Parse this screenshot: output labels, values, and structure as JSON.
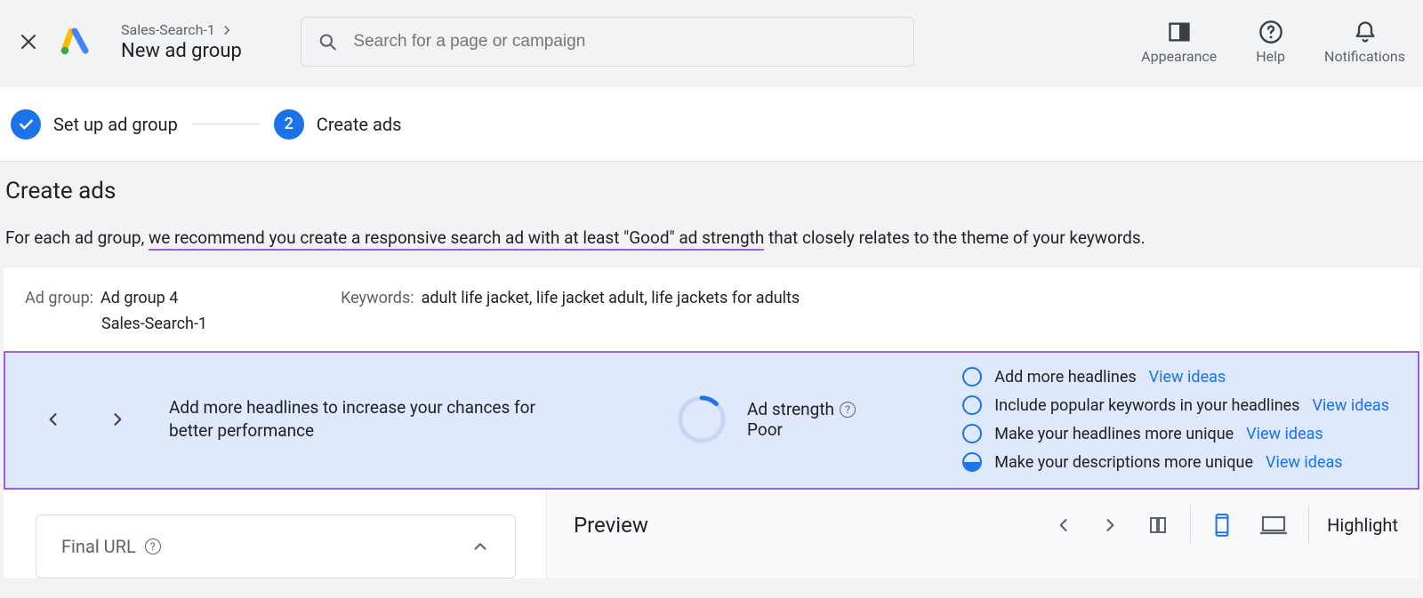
{
  "header": {
    "breadcrumb_campaign": "Sales-Search-1",
    "breadcrumb_title": "New ad group",
    "search_placeholder": "Search for a page or campaign",
    "actions": {
      "appearance": "Appearance",
      "help": "Help",
      "notifications": "Notifications"
    }
  },
  "stepper": {
    "step1_label": "Set up ad group",
    "step2_number": "2",
    "step2_label": "Create ads"
  },
  "section": {
    "title": "Create ads",
    "desc_pre": "For each ad group, ",
    "desc_underlined": "we recommend you create a responsive search ad with at least \"Good\" ad strength",
    "desc_post": " that closely relates to the theme of your keywords."
  },
  "card": {
    "adgroup_label": "Ad group:",
    "adgroup_value": "Ad group 4",
    "adgroup_campaign": "Sales-Search-1",
    "keywords_label": "Keywords:",
    "keywords_value": "adult life jacket, life jacket adult, life jackets for adults"
  },
  "suggest": {
    "text": "Add more headlines to increase your chances for better performance",
    "strength_label": "Ad strength",
    "strength_value": "Poor",
    "recs": [
      {
        "label": "Add more headlines",
        "link": "View ideas",
        "state": "empty"
      },
      {
        "label": "Include popular keywords in your headlines",
        "link": "View ideas",
        "state": "empty"
      },
      {
        "label": "Make your headlines more unique",
        "link": "View ideas",
        "state": "empty"
      },
      {
        "label": "Make your descriptions more unique",
        "link": "View ideas",
        "state": "half"
      }
    ]
  },
  "bottom": {
    "final_url_label": "Final URL",
    "preview_label": "Preview",
    "highlight_label": "Highlight"
  }
}
